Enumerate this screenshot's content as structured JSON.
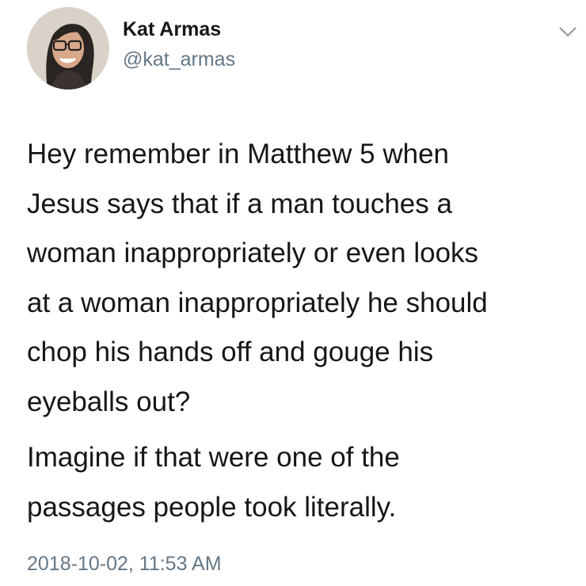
{
  "user": {
    "display_name": "Kat Armas",
    "handle": "@kat_armas"
  },
  "avatar_icon": "profile-photo",
  "menu_icon": "chevron-down-icon",
  "tweet": {
    "paragraphs": [
      {
        "lines": [
          "Hey remember in Matthew 5 when",
          "Jesus says that if a man touches a",
          "woman inappropriately or even looks",
          "at a woman inappropriately he should",
          "chop his hands off and gouge his",
          "eyeballs out?"
        ]
      },
      {
        "lines": [
          "Imagine if that were one of the",
          "passages people took literally."
        ]
      }
    ]
  },
  "timestamp": "2018-10-02, 11:53 AM",
  "colors": {
    "text": "#14171a",
    "secondary": "#657786",
    "background": "#ffffff"
  }
}
